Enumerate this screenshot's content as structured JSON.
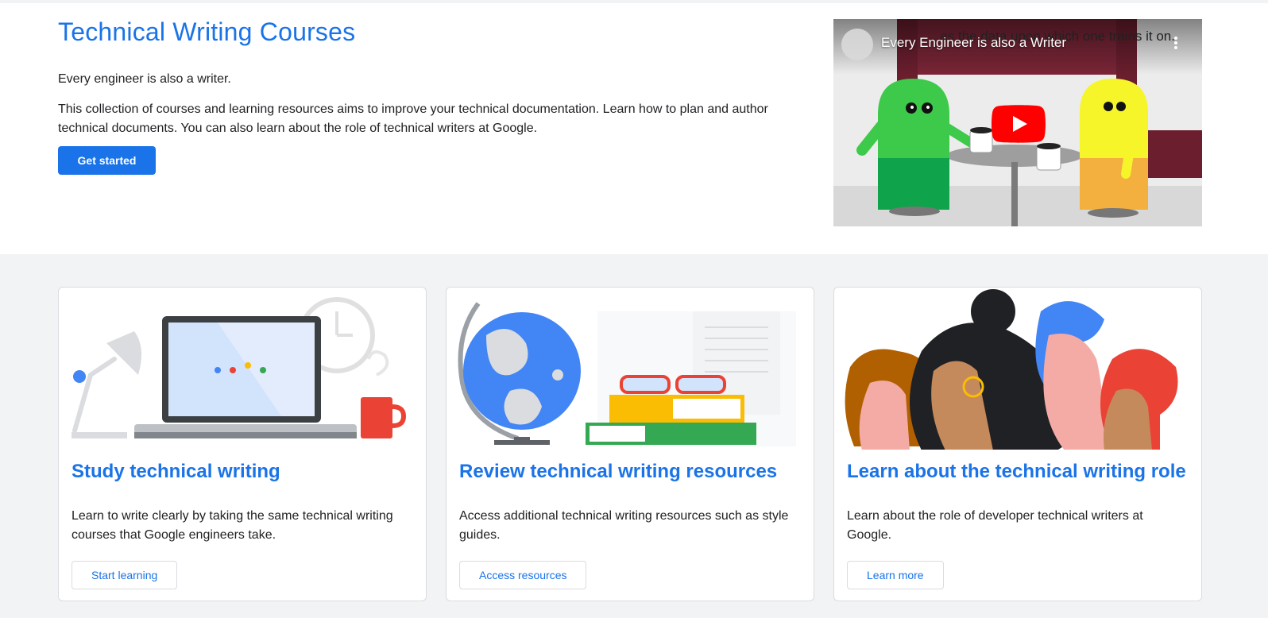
{
  "hero": {
    "title": "Technical Writing Courses",
    "tagline": "Every engineer is also a writer.",
    "description": "This collection of courses and learning resources aims to improve your technical documentation. Learn how to plan and author technical documents. You can also learn about the role of technical writers at Google.",
    "cta_label": "Get started"
  },
  "video": {
    "title": "Every Engineer is also a Writer",
    "caption": "...as the data upon which one trains it on.",
    "play_icon": "play-icon",
    "menu_icon": "more-vert-icon"
  },
  "cards": [
    {
      "title": "Study technical writing",
      "description": "Learn to write clearly by taking the same technical writing courses that Google engineers take.",
      "button_label": "Start learning",
      "illustration": "laptop-lamp-illustration"
    },
    {
      "title": "Review technical writing resources",
      "description": "Access additional technical writing resources such as style guides.",
      "button_label": "Access resources",
      "illustration": "globe-books-illustration"
    },
    {
      "title": "Learn about the technical writing role",
      "description": "Learn about the role of developer technical writers at Google.",
      "button_label": "Learn more",
      "illustration": "people-profiles-illustration"
    }
  ],
  "colors": {
    "accent": "#1a73e8",
    "background_lower": "#f1f3f4",
    "youtube_red": "#ff0000"
  }
}
